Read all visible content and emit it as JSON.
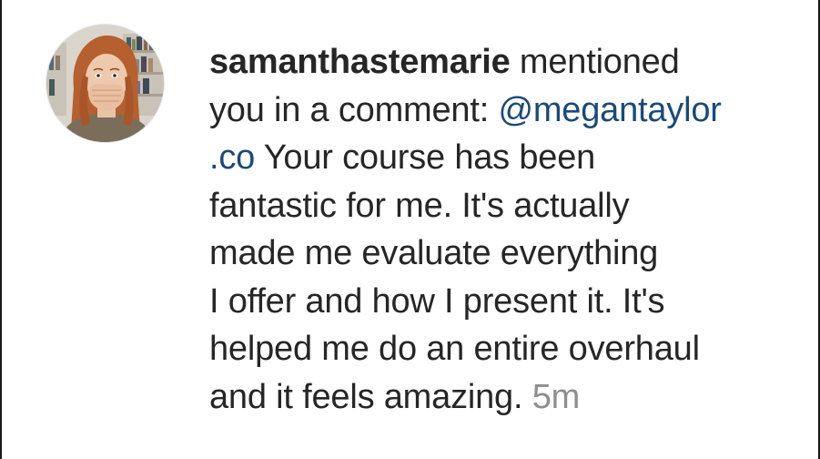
{
  "notification": {
    "username": "samanthastemarie",
    "action_text": " mentioned",
    "line2_text": "you in a comment: ",
    "mention_part1": "@megantaylor",
    "mention_part2": ".co",
    "line3_text": " Your course has been",
    "line4_text": "fantastic for me. It's actually",
    "line5_text": "made me evaluate everything",
    "line6_text": "I offer and how I present it. It's",
    "line7_text": "helped me do an entire overhaul",
    "line8_text": "and it feels amazing. ",
    "timestamp": "5m"
  },
  "colors": {
    "text": "#262626",
    "mention": "#1a4a7a",
    "timestamp": "#8e8e8e",
    "background": "#ffffff"
  }
}
